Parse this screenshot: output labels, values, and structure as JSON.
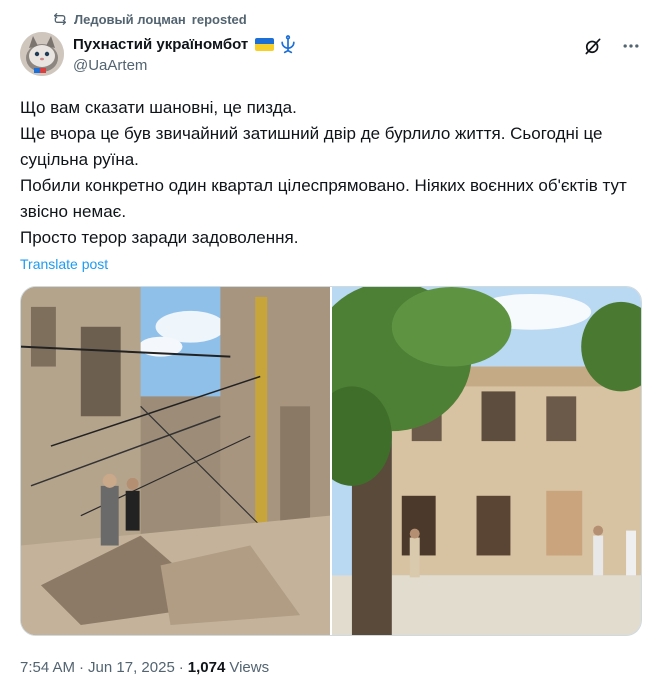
{
  "repost": {
    "icon": "repost-icon",
    "user": "Ледовый лоцман",
    "suffix": "reposted"
  },
  "author": {
    "display_name": "Пухнастий україномбот",
    "handle": "@UaArtem",
    "badges": [
      "ukraine-flag-icon",
      "trident-icon"
    ],
    "colors": {
      "flag_blue": "#1d6fd6",
      "flag_yellow": "#f7cf2a",
      "trident": "#1d6fd6"
    }
  },
  "actions": {
    "grok_icon": "grok-icon",
    "more_icon": "more-icon"
  },
  "tweet": {
    "lines": [
      "Що вам сказати шановні, це пизда.",
      "Ще вчора це був звичайний затишний двір де бурлило життя. Сьогодні це суцільна руїна.",
      "Побили конкретно один квартал цілеспрямовано. Ніяких воєнних об'єктів тут звісно немає.",
      "Просто терор заради задоволення."
    ],
    "translate_label": "Translate post"
  },
  "media": {
    "photos": [
      "destroyed-courtyard-photo",
      "damaged-building-photo"
    ]
  },
  "meta": {
    "time": "7:54 AM",
    "separator1": "·",
    "date": "Jun 17, 2025",
    "separator2": "·",
    "views_count": "1,074",
    "views_label": "Views"
  },
  "colors": {
    "text": "#0f1419",
    "secondary": "#536471",
    "link": "#1d9bf0",
    "border": "#cfd9de"
  }
}
